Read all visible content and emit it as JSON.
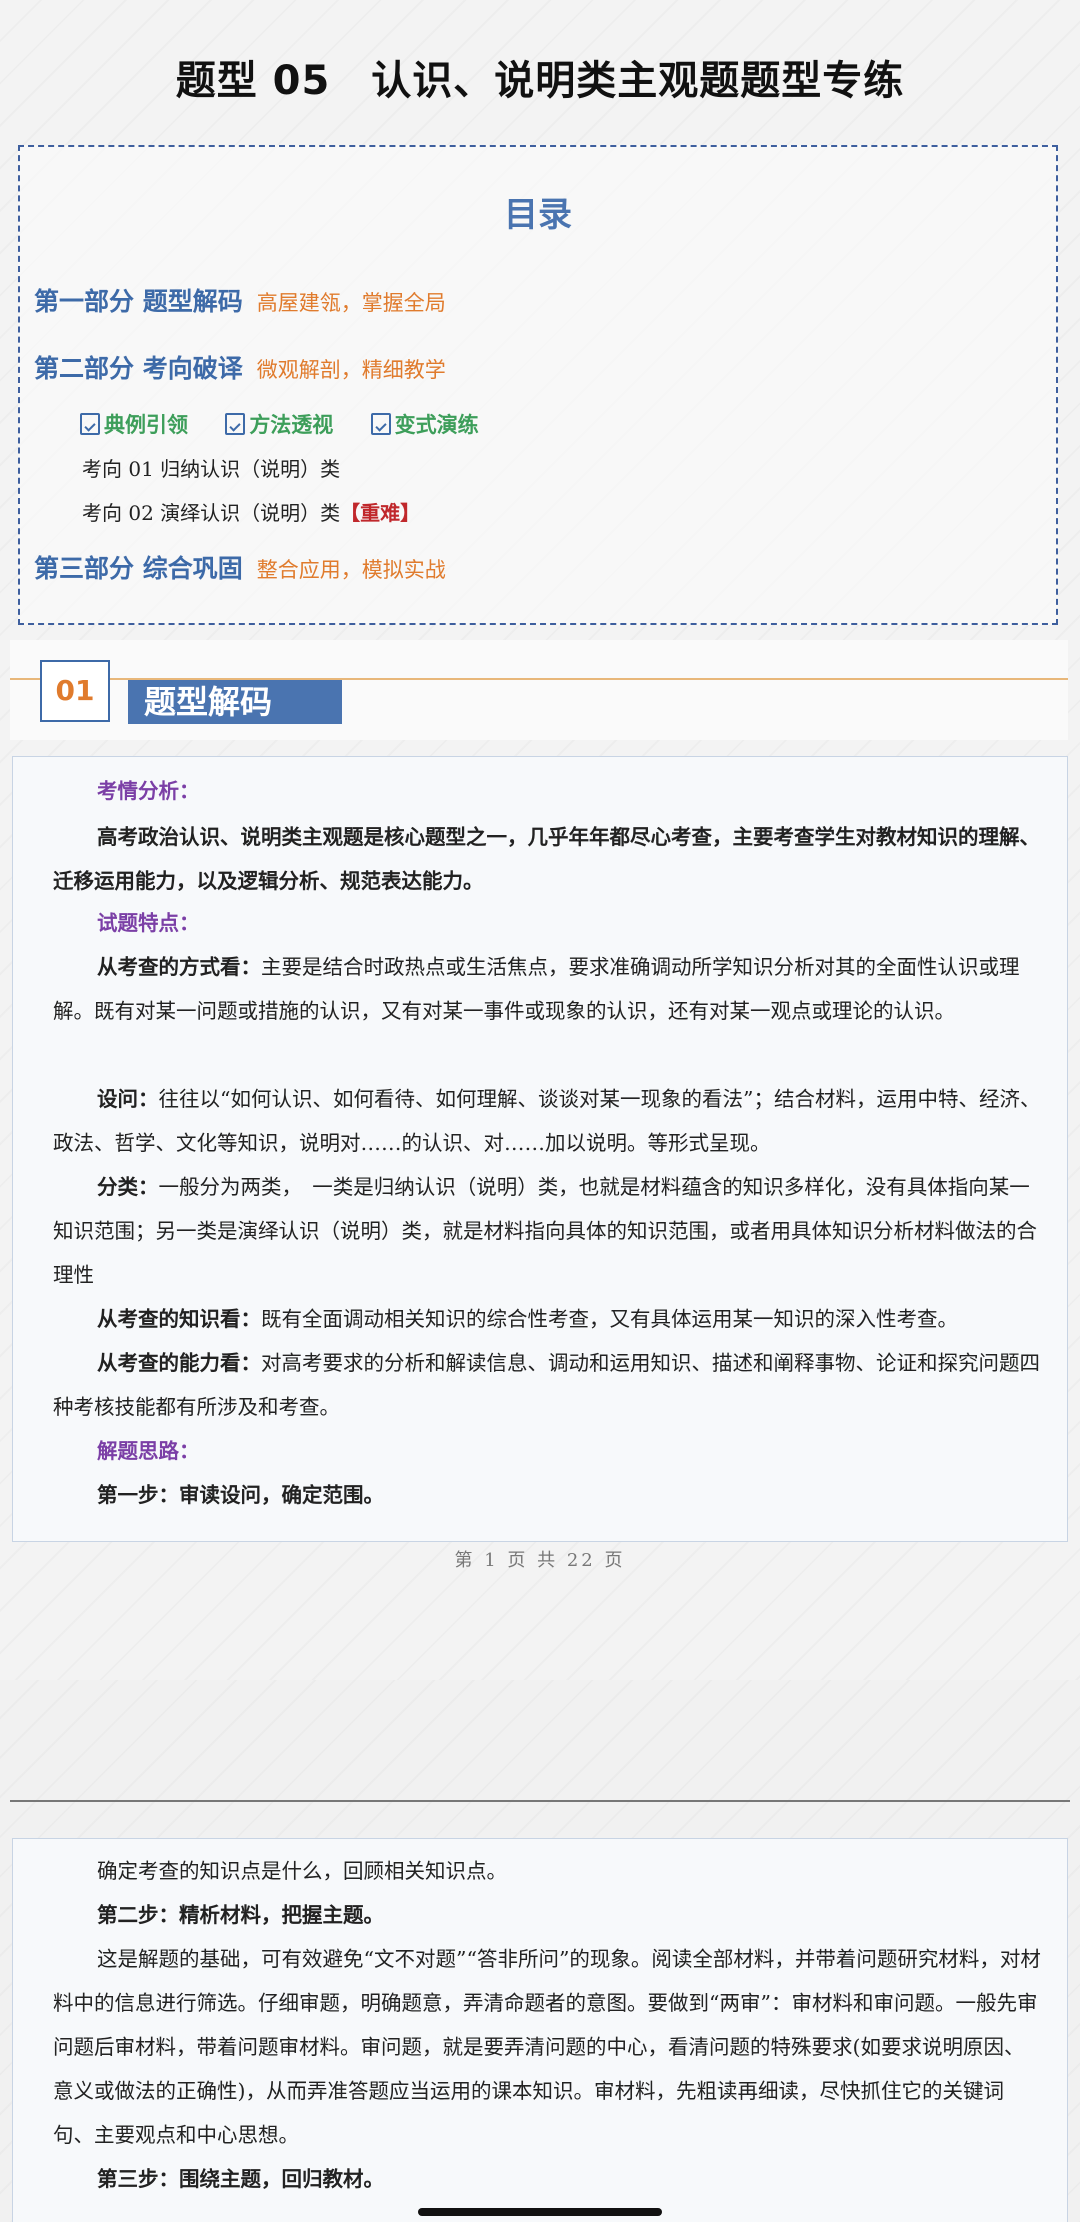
{
  "title": "题型 05　认识、说明类主观题题型专练",
  "toc": {
    "heading": "目录",
    "part1": {
      "label": "第一部分 题型解码",
      "sub": "高屋建瓴，掌握全局"
    },
    "part2": {
      "label": "第二部分 考向破译",
      "sub": "微观解剖，精细教学"
    },
    "icons": [
      "典例引领",
      "方法透视",
      "变式演练"
    ],
    "dir1": "考向 01 归纳认识（说明）类",
    "dir2": "考向 02 演绎认识（说明）类",
    "dir2_tag": "【重难】",
    "part3": {
      "label": "第三部分 综合巩固",
      "sub": "整合应用，模拟实战"
    }
  },
  "section": {
    "number": "01",
    "label": "题型解码"
  },
  "page1": {
    "h1": "考情分析：",
    "p1": "高考政治认识、说明类主观题是核心题型之一，几乎年年都尽心考查，主要考查学生对教材知识的理解、迁移运用能力，以及逻辑分析、规范表达能力。",
    "h2": "试题特点：",
    "p2_lead": "从考查的方式看：",
    "p2": "主要是结合时政热点或生活焦点，要求准确调动所学知识分析对其的全面性认识或理解。既有对某一问题或措施的认识，又有对某一事件或现象的认识，还有对某一观点或理论的认识。",
    "p3_lead": "设问：",
    "p3": "往往以“如何认识、如何看待、如何理解、谈谈对某一现象的看法”；结合材料，运用中特、经济、政法、哲学、文化等知识，说明对……的认识、对……加以说明。等形式呈现。",
    "p4_lead": "分类：",
    "p4": "一般分为两类，　一类是归纳认识（说明）类，也就是材料蕴含的知识多样化，没有具体指向某一知识范围；另一类是演绎认识（说明）类，就是材料指向具体的知识范围，或者用具体知识分析材料做法的合理性",
    "p5_lead": "从考查的知识看：",
    "p5": "既有全面调动相关知识的综合性考查，又有具体运用某一知识的深入性考查。",
    "p6_lead": "从考查的能力看：",
    "p6": "对高考要求的分析和解读信息、调动和运用知识、描述和阐释事物、论证和探究问题四种考核技能都有所涉及和考查。",
    "h3": "解题思路：",
    "step1": "第一步：审读设问，确定范围。",
    "footer": "第 1 页 共 22 页"
  },
  "page2": {
    "p1": "确定考查的知识点是什么，回顾相关知识点。",
    "step2": "第二步：精析材料，把握主题。",
    "p2": "这是解题的基础，可有效避免“文不对题”“答非所问”的现象。阅读全部材料，并带着问题研究材料，对材料中的信息进行筛选。仔细审题，明确题意，弄清命题者的意图。要做到“两审”：审材料和审问题。一般先审问题后审材料，带着问题审材料。审问题，就是要弄清问题的中心，看清问题的特殊要求(如要求说明原因、意义或做法的正确性)，从而弄准答题应当运用的课本知识。审材料，先粗读再细读，尽快抓住它的关键词句、主要观点和中心思想。",
    "step3": "第三步：围绕主题，回归教材。"
  }
}
